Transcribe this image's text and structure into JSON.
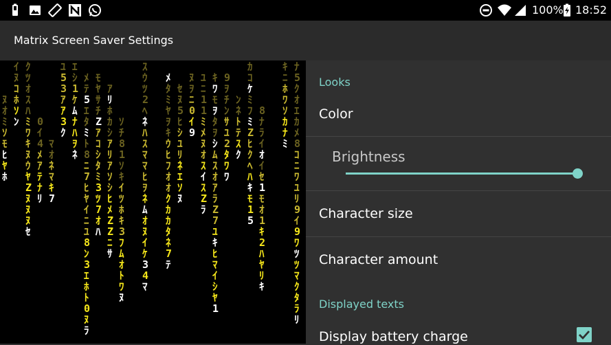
{
  "status_bar": {
    "battery_text": "100%",
    "time": "18:52",
    "left_icons": [
      "battery-saver-icon",
      "image-icon",
      "screen-rotation-icon",
      "n-notification-icon",
      "whatsapp-icon"
    ],
    "right_icons": [
      "do-not-disturb-icon",
      "wifi-icon",
      "signal-icon",
      "battery-charging-icon"
    ]
  },
  "app_bar": {
    "title": "Matrix Screen Saver Settings"
  },
  "preview": {
    "colors": {
      "bright": "#f6e71a",
      "mid": "#c9b830",
      "dim": "#6b6220",
      "white": "#ffffff"
    }
  },
  "settings": {
    "looks_category": "Looks",
    "color_title": "Color",
    "brightness_label": "Brightness",
    "brightness_value": 1.0,
    "character_size_title": "Character size",
    "character_amount_title": "Character amount",
    "displayed_texts_category": "Displayed texts",
    "display_battery_title": "Display battery charge",
    "display_battery_checked": true
  },
  "accent_color": "#7fd3c8"
}
